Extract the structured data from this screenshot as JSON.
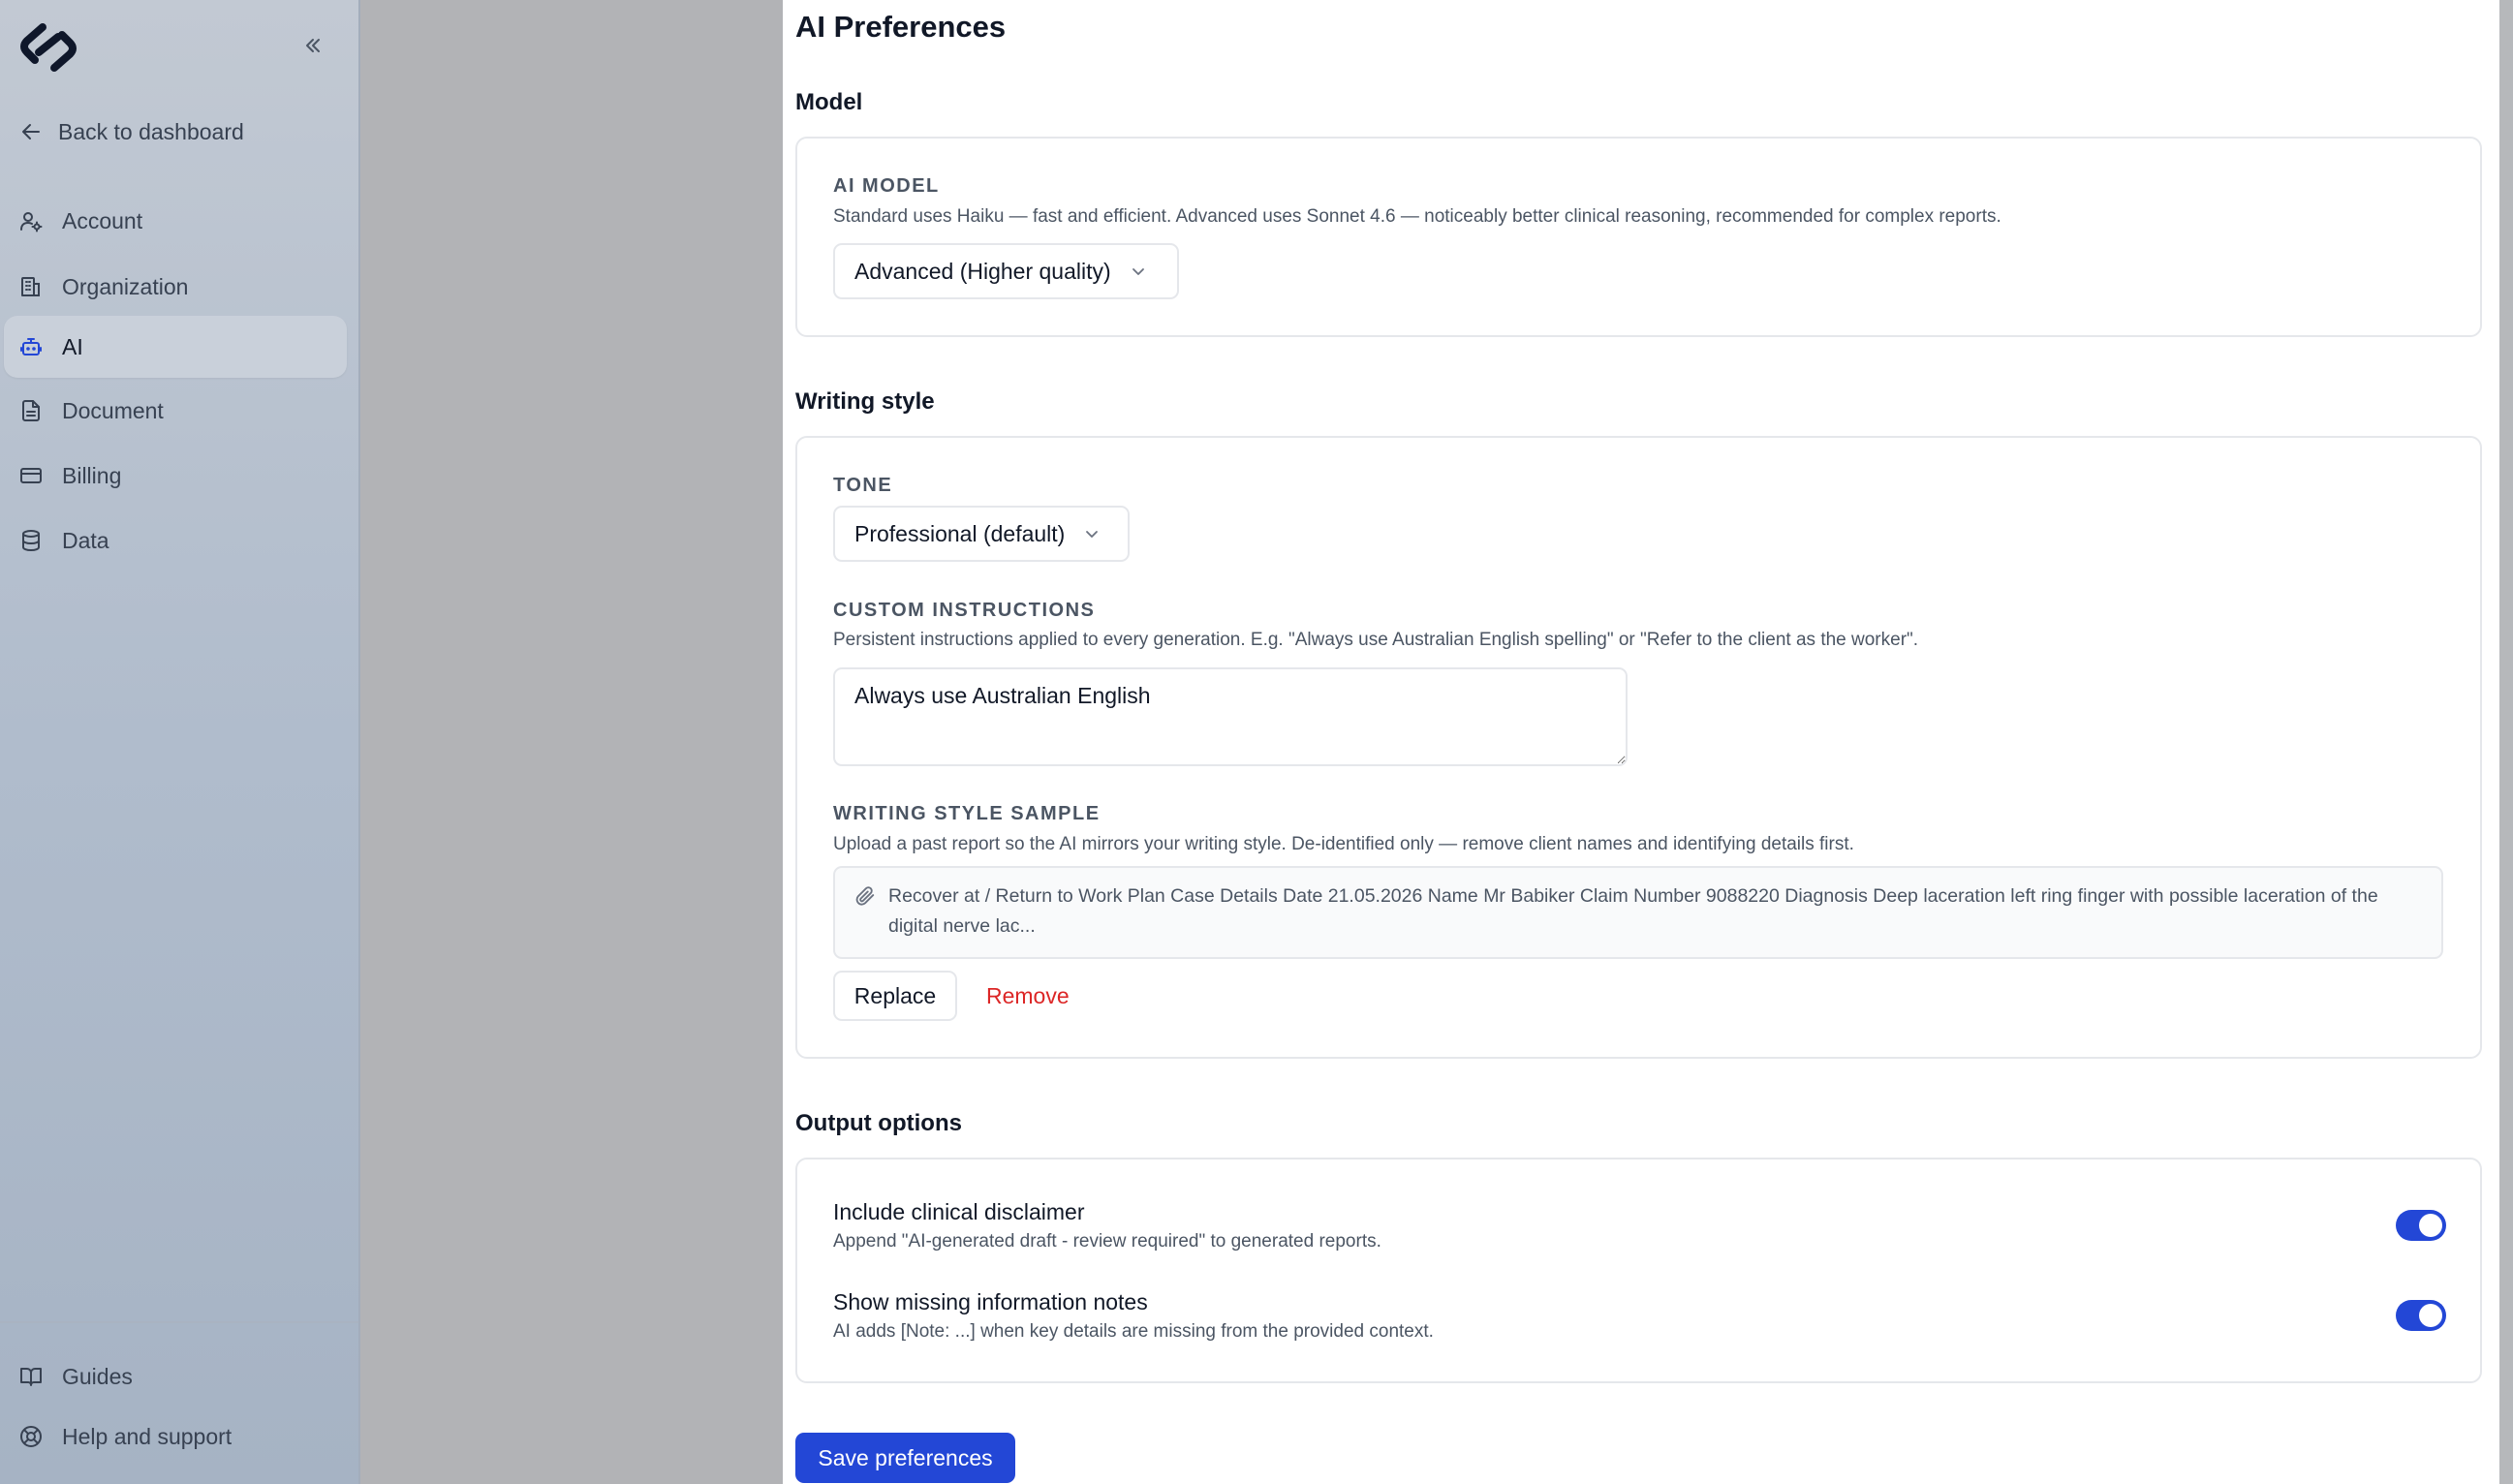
{
  "sidebar": {
    "back_label": "Back to dashboard",
    "items": [
      {
        "label": "Account",
        "icon": "user-cog-icon"
      },
      {
        "label": "Organization",
        "icon": "building-icon"
      },
      {
        "label": "AI",
        "icon": "bot-icon",
        "active": true
      },
      {
        "label": "Document",
        "icon": "document-icon"
      },
      {
        "label": "Billing",
        "icon": "credit-card-icon"
      },
      {
        "label": "Data",
        "icon": "database-icon"
      }
    ],
    "footer": [
      {
        "label": "Guides",
        "icon": "book-icon"
      },
      {
        "label": "Help and support",
        "icon": "lifebuoy-icon"
      }
    ]
  },
  "page": {
    "title": "AI Preferences",
    "model": {
      "section_title": "Model",
      "label": "AI MODEL",
      "help": "Standard uses Haiku — fast and efficient. Advanced uses Sonnet 4.6 — noticeably better clinical reasoning, recommended for complex reports.",
      "selected": "Advanced (Higher quality)"
    },
    "writing": {
      "section_title": "Writing style",
      "tone_label": "TONE",
      "tone_selected": "Professional (default)",
      "custom_label": "CUSTOM INSTRUCTIONS",
      "custom_help": "Persistent instructions applied to every generation. E.g. \"Always use Australian English spelling\" or \"Refer to the client as the worker\".",
      "custom_value": "Always use Australian English",
      "sample_label": "WRITING STYLE SAMPLE",
      "sample_help": "Upload a past report so the AI mirrors your writing style. De-identified only — remove client names and identifying details first.",
      "sample_text": "Recover at / Return to Work Plan Case Details Date 21.05.2026 Name Mr Babiker Claim Number 9088220 Diagnosis Deep laceration left ring finger with possible laceration of the digital nerve lac...",
      "replace_label": "Replace",
      "remove_label": "Remove"
    },
    "output": {
      "section_title": "Output options",
      "options": [
        {
          "title": "Include clinical disclaimer",
          "desc": "Append \"AI-generated draft - review required\" to generated reports.",
          "enabled": true
        },
        {
          "title": "Show missing information notes",
          "desc": "AI adds [Note: ...] when key details are missing from the provided context.",
          "enabled": true
        }
      ]
    },
    "save_label": "Save preferences"
  },
  "colors": {
    "accent": "#2347d6",
    "danger": "#dc2626",
    "sidebar_top": "#c2c9d3",
    "sidebar_bottom": "#a6b3c4"
  }
}
